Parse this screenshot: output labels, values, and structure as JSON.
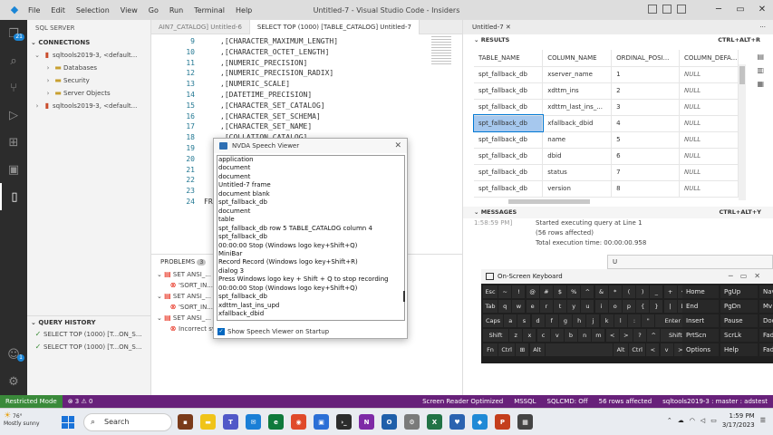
{
  "window": {
    "title": "Untitled-7 - Visual Studio Code - Insiders",
    "menu": [
      "File",
      "Edit",
      "Selection",
      "View",
      "Go",
      "Run",
      "Terminal",
      "Help"
    ]
  },
  "activity": {
    "badge": "21",
    "accounts_badge": "1"
  },
  "sidebar": {
    "header": "SQL SERVER",
    "connections_title": "CONNECTIONS",
    "tree": [
      {
        "label": "sqltools2019-3, <default...",
        "level": 0,
        "chevron": "v",
        "icon": "db"
      },
      {
        "label": "Databases",
        "level": 1,
        "chevron": ">",
        "icon": "folder"
      },
      {
        "label": "Security",
        "level": 1,
        "chevron": ">",
        "icon": "folder"
      },
      {
        "label": "Server Objects",
        "level": 1,
        "chevron": ">",
        "icon": "folder"
      },
      {
        "label": "sqltools2019-3, <default...",
        "level": 0,
        "chevron": ">",
        "icon": "db"
      }
    ],
    "query_history_title": "QUERY HISTORY",
    "history": [
      {
        "label": "SELECT TOP (1000) [T...ON_S..."
      },
      {
        "label": "SELECT TOP (1000) [T...ON_S..."
      }
    ]
  },
  "editor": {
    "tabs": [
      "AIN7_CATALOG] Untitled-6",
      "SELECT TOP (1000) [TABLE_CATALOG] Untitled-7"
    ],
    "lines": [
      {
        "n": "9",
        "text": ",[CHARACTER_MAXIMUM_LENGTH]"
      },
      {
        "n": "10",
        "text": ",[CHARACTER_OCTET_LENGTH]"
      },
      {
        "n": "11",
        "text": ",[NUMERIC_PRECISION]"
      },
      {
        "n": "12",
        "text": ",[NUMERIC_PRECISION_RADIX]"
      },
      {
        "n": "13",
        "text": ",[NUMERIC_SCALE]"
      },
      {
        "n": "14",
        "text": ",[DATETIME_PRECISION]"
      },
      {
        "n": "15",
        "text": ",[CHARACTER_SET_CATALOG]"
      },
      {
        "n": "16",
        "text": ",[CHARACTER_SET_SCHEMA]"
      },
      {
        "n": "17",
        "text": ",[CHARACTER_SET_NAME]"
      },
      {
        "n": "18",
        "text": ",[COLLATION_CATALOG]"
      },
      {
        "n": "19",
        "text": ""
      },
      {
        "n": "20",
        "text": ""
      },
      {
        "n": "21",
        "text": ""
      },
      {
        "n": "22",
        "text": ""
      },
      {
        "n": "23",
        "text": ""
      },
      {
        "n": "24",
        "text": "FROM"
      }
    ]
  },
  "panel": {
    "tab_label": "PROBLEMS",
    "tab_count": "3",
    "problems": [
      {
        "kind": "group",
        "text": "SET ANSI_..."
      },
      {
        "kind": "error",
        "text": "'SORT_IN..."
      },
      {
        "kind": "group",
        "text": "SET ANSI_..."
      },
      {
        "kind": "error",
        "text": "'SORT_IN..."
      },
      {
        "kind": "group",
        "text": "SET ANSI_..."
      },
      {
        "kind": "error",
        "text": "Incorrect syntax near ','. [Ln 48, Col 9]"
      }
    ],
    "col_refs": [
      "Col 55]",
      "Col 55]"
    ]
  },
  "results": {
    "tab_title": "Untitled-7",
    "results_title": "RESULTS",
    "results_shortcut": "CTRL+ALT+R",
    "columns": [
      "TABLE_NAME",
      "COLUMN_NAME",
      "ORDINAL_POSI...",
      "COLUMN_DEFA..."
    ],
    "rows": [
      [
        "spt_fallback_db",
        "xserver_name",
        "1",
        "NULL"
      ],
      [
        "spt_fallback_db",
        "xdttm_ins",
        "2",
        "NULL"
      ],
      [
        "spt_fallback_db",
        "xdttm_last_ins_...",
        "3",
        "NULL"
      ],
      [
        "spt_fallback_db",
        "xfallback_dbid",
        "4",
        "NULL"
      ],
      [
        "spt_fallback_db",
        "name",
        "5",
        "NULL"
      ],
      [
        "spt_fallback_db",
        "dbid",
        "6",
        "NULL"
      ],
      [
        "spt_fallback_db",
        "status",
        "7",
        "NULL"
      ],
      [
        "spt_fallback_db",
        "version",
        "8",
        "NULL"
      ]
    ],
    "selected_row": 3,
    "messages_title": "MESSAGES",
    "messages_shortcut": "CTRL+ALT+Y",
    "messages": [
      {
        "time": "1:58:59 PM]",
        "text": "Started executing query at Line 1"
      },
      {
        "time": "",
        "text": "(56 rows affected)"
      },
      {
        "time": "",
        "text": "Total execution time: 00:00:00.958"
      }
    ]
  },
  "nvda": {
    "title": "NVDA Speech Viewer",
    "lines": [
      "application",
      "document",
      "document",
      "Untitled-7  frame",
      "document  blank",
      "spt_fallback_db",
      "document",
      "table",
      "spt_fallback_db  row 5  TABLE_CATALOG  column 4",
      "spt_fallback_db",
      "00:00:00 Stop (Windows logo key+Shift+Q)",
      "MiniBar",
      "Record Record (Windows logo key+Shift+R)",
      "dialog  3",
      "Press Windows logo key + Shift + Q to stop recording",
      "00:00:00 Stop (Windows logo key+Shift+Q)",
      "spt_fallback_db",
      "xdttm_last_ins_upd",
      "xfallback_dbid"
    ],
    "checkbox_label": "Show Speech Viewer on Startup"
  },
  "search_strip": {
    "value": "U"
  },
  "osk": {
    "title": "On-Screen Keyboard",
    "rows": [
      [
        "Esc",
        "~",
        "!",
        "@",
        "#",
        "$",
        "%",
        "^",
        "&",
        "*",
        "(",
        ")",
        "_",
        "+",
        "⌫"
      ],
      [
        "Tab",
        "q",
        "w",
        "e",
        "r",
        "t",
        "y",
        "u",
        "i",
        "o",
        "p",
        "{",
        "}",
        "|",
        "Del"
      ],
      [
        "Caps",
        "a",
        "s",
        "d",
        "f",
        "g",
        "h",
        "j",
        "k",
        "l",
        ":",
        "\"",
        "Enter"
      ],
      [
        "Shift",
        "z",
        "x",
        "c",
        "v",
        "b",
        "n",
        "m",
        "<",
        ">",
        "?",
        "^",
        "Shift"
      ],
      [
        "Fn",
        "Ctrl",
        "⊞",
        "Alt",
        "",
        "Alt",
        "Ctrl",
        "<",
        "v",
        ">",
        "≡"
      ]
    ],
    "side": [
      [
        "Home",
        "PgUp",
        "Nav"
      ],
      [
        "End",
        "PgDn",
        "Mv"
      ],
      [
        "Insert",
        "Pause",
        "Dock"
      ],
      [
        "PrtScn",
        "ScrLk",
        "Fade"
      ],
      [
        "Options",
        "Help",
        "Fade"
      ]
    ]
  },
  "statusbar": {
    "restricted": "Restricted Mode",
    "problems": "⊗ 3 ⚠ 0",
    "right": [
      "Screen Reader Optimized",
      "MSSQL",
      "SQLCMD: Off",
      "56 rows affected",
      "sqltools2019-3 : master : adstest"
    ]
  },
  "taskbar": {
    "temp": "76°",
    "weather": "Mostly sunny",
    "search": "Search",
    "time": "1:59 PM",
    "date": "3/17/2023"
  }
}
